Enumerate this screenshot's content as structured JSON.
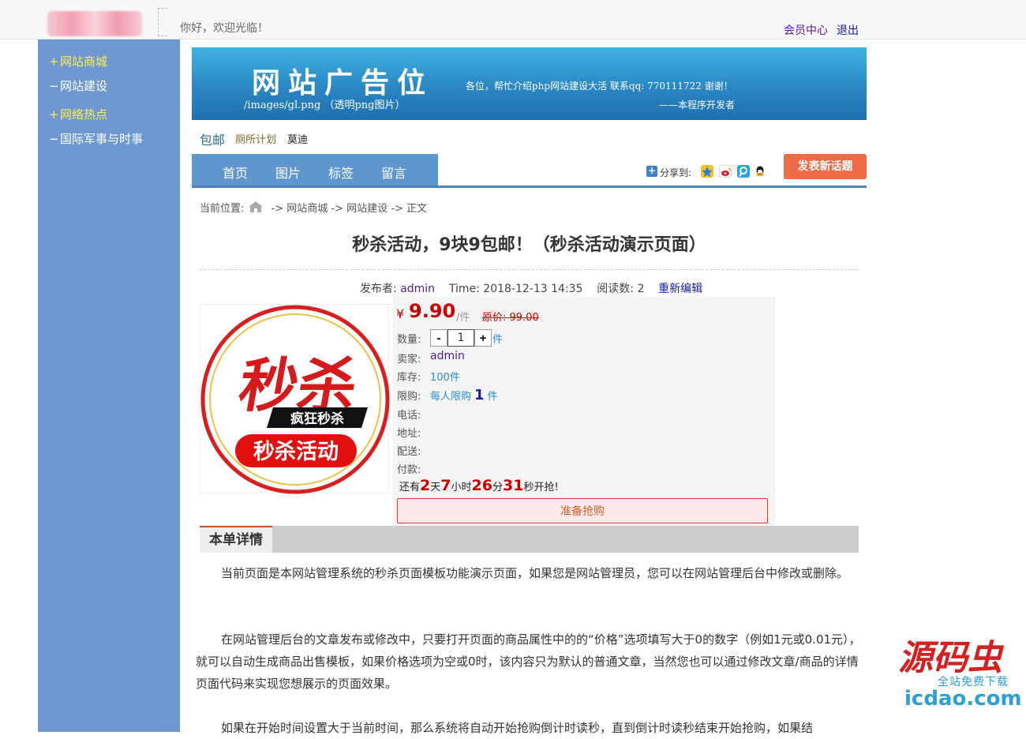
{
  "header": {
    "welcome": "你好，欢迎光临！",
    "member_center": "会员中心",
    "logout": "退出"
  },
  "sidebar": {
    "items": [
      {
        "mark": "+",
        "label": "网站商城"
      },
      {
        "mark": "−",
        "label": "网站建设"
      },
      {
        "mark": "+",
        "label": "网络热点"
      },
      {
        "mark": "−",
        "label": "国际军事与时事"
      }
    ]
  },
  "banner": {
    "title": "网站广告位",
    "path": "/images/gl.png （透明png图片）",
    "message": "各位，帮忙介绍php网站建设大活  联系qq: 770111722 谢谢！",
    "signature": "——本程序开发者"
  },
  "tags": [
    "包邮",
    "厕所计划",
    "莫迪"
  ],
  "nav": {
    "items": [
      "首页",
      "图片",
      "标签",
      "留言"
    ],
    "share_label": "分享到:",
    "post_button": "发表新话题"
  },
  "breadcrumb": {
    "prefix": "当前位置:",
    "sep": "->",
    "items": [
      "网站商城",
      "网站建设",
      "正文"
    ]
  },
  "article": {
    "title": "秒杀活动，9块9包邮！（秒杀活动演示页面）",
    "author_label": "发布者:",
    "author": "admin",
    "time": "Time: 2018-12-13 14:35",
    "views_label": "阅读数:",
    "views": "2",
    "reedit": "重新编辑"
  },
  "product": {
    "image_text_main": "秒杀",
    "image_text_sub": "疯狂秒杀",
    "image_text_bottom": "秒杀活动",
    "currency": "¥",
    "price": "9.90",
    "price_unit": "/件",
    "original_price": "原价: 99.00",
    "qty_label": "数量:",
    "qty_minus": "-",
    "qty_value": "1",
    "qty_plus": "+",
    "qty_unit": "件",
    "seller_label": "卖家:",
    "seller": "admin",
    "stock_label": "库存:",
    "stock": "100件",
    "limit_label": "限购:",
    "limit_text": "每人限购",
    "limit_num": "1",
    "limit_unit": "件",
    "phone_label": "电话:",
    "address_label": "地址:",
    "delivery_label": "配送:",
    "payment_label": "付款:",
    "countdown": {
      "prefix": "还有",
      "days": "2",
      "days_unit": "天",
      "hours": "7",
      "hours_unit": "小时",
      "minutes": "26",
      "minutes_unit": "分",
      "seconds": "31",
      "suffix": "秒开抢!"
    },
    "buy_button": "准备抢购"
  },
  "details": {
    "tab": "本单详情",
    "paragraphs": [
      "当前页面是本网站管理系统的秒杀页面模板功能演示页面，如果您是网站管理员，您可以在网站管理后台中修改或删除。",
      "在网站管理后台的文章发布或修改中，只要打开页面的商品属性中的的“价格”选项填写大于0的数字（例如1元或0.01元），就可以自动生成商品出售模板，如果价格选项为空或0时，该内容只为默认的普通文章，当然您也可以通过修改文章/商品的详情页面代码来实现您想展示的页面效果。",
      "如果在开始时间设置大于当前时间，那么系统将自动开始抢购倒计时读秒，直到倒计时读秒结束开始抢购，如果结"
    ]
  },
  "watermark": {
    "logo_text": "源码虫",
    "subtitle": "全站免费下载",
    "url": "icdao.com"
  }
}
